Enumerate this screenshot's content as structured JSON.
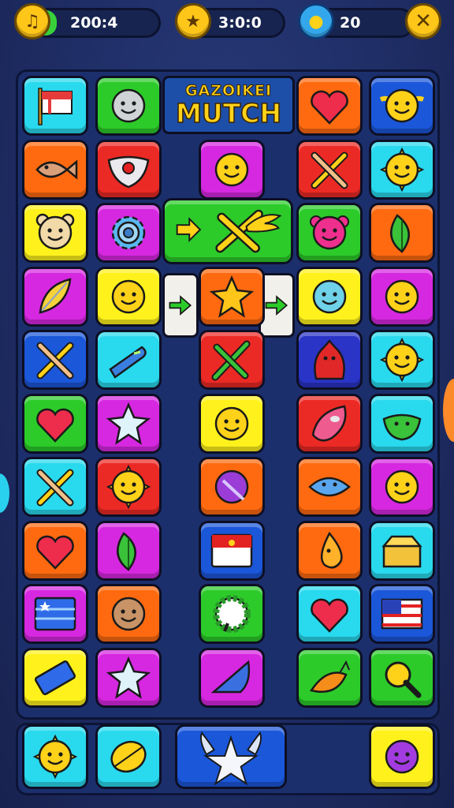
{
  "hud": {
    "coins": {
      "value": "200:4",
      "icon": "music-note-coin-icon"
    },
    "timer": {
      "value": "3:0:0",
      "icon": "medal-icon"
    },
    "drops": {
      "value": "20",
      "icon": "water-drop-icon"
    },
    "close_icon": "close-icon"
  },
  "banner": {
    "subtitle": "GAZOIKEI",
    "title": "MUTCH"
  },
  "colors": {
    "cyan": "#29d9ee",
    "green": "#2ccb2a",
    "magenta": "#d628e0",
    "orange": "#ff6a10",
    "red": "#ec2a25",
    "yellow": "#fff21c",
    "blue": "#1b57d9",
    "navy": "#2a34c7",
    "gold_icon": "#ffd21a",
    "board_bg": "#1c2f6d"
  },
  "tiles": [
    {
      "row": 1,
      "col": 1,
      "color": "cyan",
      "icon": "flag-icon"
    },
    {
      "row": 1,
      "col": 2,
      "color": "green",
      "icon": "grey-face-icon"
    },
    {
      "row": 1,
      "col": 5,
      "color": "orange",
      "icon": "heart-icon"
    },
    {
      "row": 1,
      "col": 6,
      "color": "blue",
      "icon": "winged-sun-face-icon"
    },
    {
      "row": 2,
      "col": 1,
      "color": "orange",
      "icon": "fish-icon"
    },
    {
      "row": 2,
      "col": 2,
      "color": "red",
      "icon": "mask-icon"
    },
    {
      "row": 2,
      "col": 3,
      "color": "magenta",
      "icon": "blob-face-icon"
    },
    {
      "row": 2,
      "col": 5,
      "color": "red",
      "icon": "crossed-swords-icon"
    },
    {
      "row": 2,
      "col": 6,
      "color": "cyan",
      "icon": "sun-face-icon"
    },
    {
      "row": 3,
      "col": 1,
      "color": "yellow",
      "icon": "bear-face-icon"
    },
    {
      "row": 3,
      "col": 2,
      "color": "magenta",
      "icon": "gear-icon"
    },
    {
      "row": 3,
      "col": 5,
      "color": "green",
      "icon": "pink-monster-icon"
    },
    {
      "row": 3,
      "col": 6,
      "color": "orange",
      "icon": "leaf-icon"
    },
    {
      "row": 4,
      "col": 1,
      "color": "magenta",
      "icon": "feather-icon"
    },
    {
      "row": 4,
      "col": 2,
      "color": "yellow",
      "icon": "smiley-icon"
    },
    {
      "row": 4,
      "col": 3,
      "color": "orange",
      "icon": "star-burst-icon"
    },
    {
      "row": 4,
      "col": 5,
      "color": "yellow",
      "icon": "drop-face-icon"
    },
    {
      "row": 4,
      "col": 6,
      "color": "magenta",
      "icon": "smiley-icon"
    },
    {
      "row": 5,
      "col": 1,
      "color": "blue",
      "icon": "crossed-swords-icon"
    },
    {
      "row": 5,
      "col": 2,
      "color": "cyan",
      "icon": "blue-blade-icon"
    },
    {
      "row": 5,
      "col": 3,
      "color": "red",
      "icon": "green-arrows-icon"
    },
    {
      "row": 5,
      "col": 5,
      "color": "navy",
      "icon": "red-creature-icon"
    },
    {
      "row": 5,
      "col": 6,
      "color": "cyan",
      "icon": "sun-face-icon"
    },
    {
      "row": 6,
      "col": 1,
      "color": "green",
      "icon": "heart-icon"
    },
    {
      "row": 6,
      "col": 2,
      "color": "magenta",
      "icon": "star-icon"
    },
    {
      "row": 6,
      "col": 3,
      "color": "yellow",
      "icon": "bubble-face-icon"
    },
    {
      "row": 6,
      "col": 5,
      "color": "red",
      "icon": "candy-icon"
    },
    {
      "row": 6,
      "col": 6,
      "color": "cyan",
      "icon": "green-slime-icon"
    },
    {
      "row": 7,
      "col": 1,
      "color": "cyan",
      "icon": "crossed-swords-icon"
    },
    {
      "row": 7,
      "col": 2,
      "color": "red",
      "icon": "sun-face-icon"
    },
    {
      "row": 7,
      "col": 3,
      "color": "orange",
      "icon": "purple-planet-icon"
    },
    {
      "row": 7,
      "col": 5,
      "color": "orange",
      "icon": "blue-fish-face-icon"
    },
    {
      "row": 7,
      "col": 6,
      "color": "magenta",
      "icon": "yellow-blob-icon"
    },
    {
      "row": 8,
      "col": 1,
      "color": "orange",
      "icon": "heart-icon"
    },
    {
      "row": 8,
      "col": 2,
      "color": "magenta",
      "icon": "leaf-icon"
    },
    {
      "row": 8,
      "col": 3,
      "color": "blue",
      "icon": "red-flag-card-icon"
    },
    {
      "row": 8,
      "col": 5,
      "color": "orange",
      "icon": "drop-icon"
    },
    {
      "row": 8,
      "col": 6,
      "color": "cyan",
      "icon": "treasure-chest-icon"
    },
    {
      "row": 9,
      "col": 1,
      "color": "magenta",
      "icon": "blue-flag-card-icon"
    },
    {
      "row": 9,
      "col": 2,
      "color": "orange",
      "icon": "coconut-face-icon"
    },
    {
      "row": 9,
      "col": 3,
      "color": "green",
      "icon": "green-ring-icon"
    },
    {
      "row": 9,
      "col": 5,
      "color": "cyan",
      "icon": "heart-icon"
    },
    {
      "row": 9,
      "col": 6,
      "color": "blue",
      "icon": "usa-flag-icon"
    },
    {
      "row": 10,
      "col": 1,
      "color": "yellow",
      "icon": "blue-bar-icon"
    },
    {
      "row": 10,
      "col": 2,
      "color": "magenta",
      "icon": "star-icon"
    },
    {
      "row": 10,
      "col": 3,
      "color": "magenta",
      "icon": "blue-shell-icon"
    },
    {
      "row": 10,
      "col": 5,
      "color": "green",
      "icon": "carrot-icon"
    },
    {
      "row": 10,
      "col": 6,
      "color": "green",
      "icon": "magnifier-icon"
    }
  ],
  "special_tiles": {
    "wing_bar": {
      "color": "green",
      "icon": "winged-sword-icon"
    },
    "arrow_left": {
      "icon": "green-arrow-icon"
    },
    "arrow_right": {
      "icon": "green-arrow-icon"
    }
  },
  "tray": [
    {
      "slot": 1,
      "color": "cyan",
      "icon": "sun-face-icon"
    },
    {
      "slot": 2,
      "color": "cyan",
      "icon": "yellow-leaf-icon"
    },
    {
      "slot": 3,
      "color": "blue",
      "icon": "winged-star-icon"
    },
    {
      "slot": 4,
      "color": "yellow",
      "icon": "purple-puff-icon"
    }
  ]
}
